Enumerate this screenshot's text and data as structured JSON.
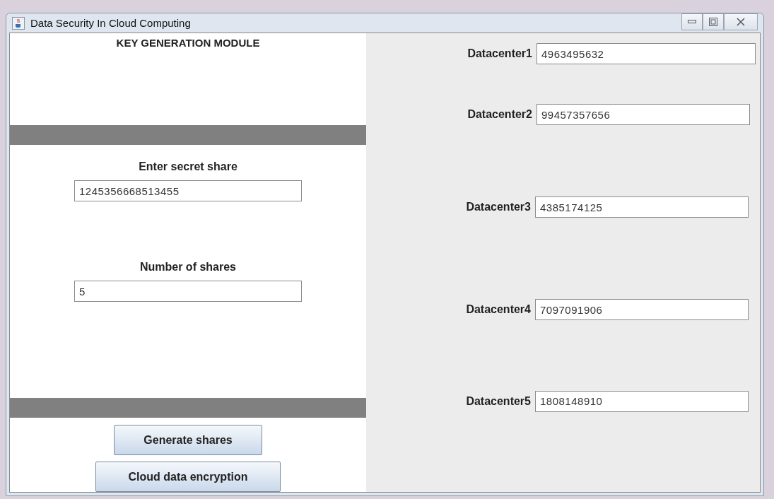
{
  "window": {
    "title": "Data Security In Cloud Computing"
  },
  "left_panel": {
    "heading": "KEY GENERATION MODULE",
    "fields": [
      {
        "label": "Enter secret share",
        "value": "1245356668513455"
      },
      {
        "label": "Number of shares",
        "value": "5"
      }
    ],
    "buttons": [
      "Generate shares",
      "Cloud data encryption"
    ]
  },
  "datacenters": [
    {
      "label": "Datacenter1",
      "value": "4963495632"
    },
    {
      "label": "Datacenter2",
      "value": "99457357656"
    },
    {
      "label": "Datacenter3",
      "value": "4385174125"
    },
    {
      "label": "Datacenter4",
      "value": "7097091906"
    },
    {
      "label": "Datacenter5",
      "value": "1808148910"
    }
  ]
}
